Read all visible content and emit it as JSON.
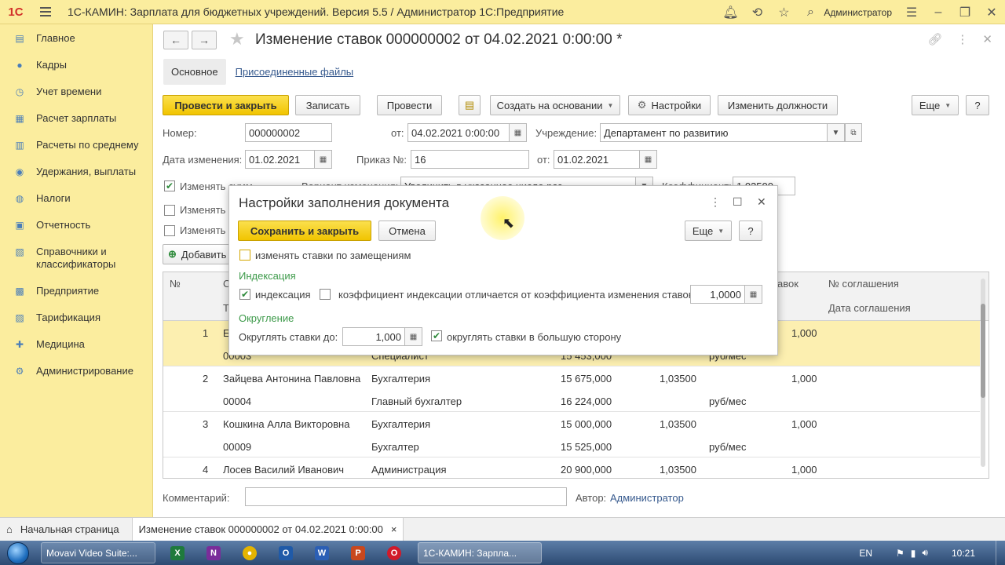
{
  "titlebar": {
    "logo": "1С",
    "title": "1С-КАМИН: Зарплата для бюджетных учреждений. Версия 5.5 / Администратор 1С:Предприятие",
    "user": "Администратор"
  },
  "sidebar": {
    "items": [
      {
        "label": "Главное",
        "icon": "home-icon"
      },
      {
        "label": "Кадры",
        "icon": "people-icon"
      },
      {
        "label": "Учет времени",
        "icon": "clock-icon"
      },
      {
        "label": "Расчет зарплаты",
        "icon": "calc-icon"
      },
      {
        "label": "Расчеты по среднему",
        "icon": "chart-icon"
      },
      {
        "label": "Удержания, выплаты",
        "icon": "wallet-icon"
      },
      {
        "label": "Налоги",
        "icon": "tax-icon"
      },
      {
        "label": "Отчетность",
        "icon": "report-icon"
      },
      {
        "label": "Справочники и классификаторы",
        "icon": "book-icon"
      },
      {
        "label": "Предприятие",
        "icon": "building-icon"
      },
      {
        "label": "Тарификация",
        "icon": "tariff-icon"
      },
      {
        "label": "Медицина",
        "icon": "medicine-icon"
      },
      {
        "label": "Администрирование",
        "icon": "settings-icon"
      }
    ]
  },
  "doc": {
    "title": "Изменение ставок 000000002 от 04.02.2021 0:00:00 *",
    "tab_main": "Основное",
    "tab_files": "Присоединенные файлы"
  },
  "toolbar": {
    "post_close": "Провести и закрыть",
    "save": "Записать",
    "post": "Провести",
    "create_based": "Создать на основании",
    "settings": "Настройки",
    "change_positions": "Изменить должности",
    "more": "Еще",
    "help": "?"
  },
  "form": {
    "number_label": "Номер:",
    "number": "000000002",
    "from_label": "от:",
    "from_date": "04.02.2021  0:00:00",
    "org_label": "Учреждение:",
    "org": "Департамент по развитию",
    "change_date_label": "Дата изменения:",
    "change_date": "01.02.2021",
    "order_label": "Приказ №:",
    "order": "16",
    "order_from_label": "от:",
    "order_date": "01.02.2021",
    "change_rates_label": "Изменять",
    "change_rates_label2": "Изменять",
    "change_rates_label3": "Изменять",
    "partial_text_1": "Изменять сумм",
    "partial_option_label": "Вариант изменения:",
    "partial_option_value": "Увеличить в указанное число раз",
    "partial_coef_label": "Коэффициент:",
    "partial_coef_value": "1,03500",
    "add_button": "Добавить"
  },
  "table": {
    "col_num": "№",
    "col_s": "С",
    "col_t": "Т",
    "col_stavok": "авок",
    "col_agreement": "№ соглашения",
    "col_agreement_date": "Дата соглашения",
    "rows": [
      {
        "n": "1",
        "name": "Е",
        "code": "00003",
        "dept": "",
        "pos": "Специалист",
        "old": "",
        "new": "15 453,000",
        "coef": "",
        "val": "1,000",
        "unit": "руб/мес"
      },
      {
        "n": "2",
        "name": "Зайцева Антонина Павловна",
        "code": "00004",
        "dept": "Бухгалтерия",
        "pos": "Главный бухгалтер",
        "old": "15 675,000",
        "new": "16 224,000",
        "coef": "1,03500",
        "val": "1,000",
        "unit": "руб/мес"
      },
      {
        "n": "3",
        "name": "Кошкина Алла Викторовна",
        "code": "00009",
        "dept": "Бухгалтерия",
        "pos": "Бухгалтер",
        "old": "15 000,000",
        "new": "15 525,000",
        "coef": "1,03500",
        "val": "1,000",
        "unit": "руб/мес"
      },
      {
        "n": "4",
        "name": "Лосев Василий Иванович",
        "code": "",
        "dept": "Администрация",
        "pos": "",
        "old": "20 900,000",
        "new": "",
        "coef": "1,03500",
        "val": "1,000",
        "unit": ""
      }
    ]
  },
  "footer": {
    "comment_label": "Комментарий:",
    "author_label": "Автор:",
    "author": "Администратор"
  },
  "dialog": {
    "title": "Настройки заполнения документа",
    "save_close": "Сохранить и закрыть",
    "cancel": "Отмена",
    "more": "Еще",
    "help": "?",
    "replace_rates": "изменять ставки по замещениям",
    "indexation_group": "Индексация",
    "indexation": "индексация",
    "coef_differs": "коэффициент индексации отличается от коэффициента изменения ставок",
    "coef_value": "1,0000",
    "rounding_group": "Округление",
    "round_to_label": "Округлять ставки до:",
    "round_to": "1,000",
    "round_up": "округлять ставки в большую сторону"
  },
  "bottom_tabs": {
    "home": "Начальная страница",
    "active": "Изменение ставок 000000002 от 04.02.2021 0:00:00"
  },
  "taskbar": {
    "app1": "Movavi Video Suite:...",
    "app2": "1С-КАМИН: Зарпла...",
    "lang": "EN",
    "time": "10:21"
  }
}
